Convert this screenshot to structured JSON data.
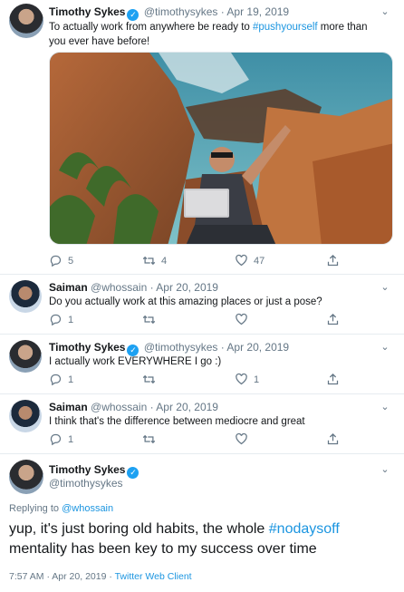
{
  "tweets": [
    {
      "name": "Timothy Sykes",
      "handle": "@timothysykes",
      "date": "Apr 19, 2019",
      "text_before": "To actually work from anywhere be ready to ",
      "hashtag": "#pushyourself",
      "text_after": " more than you ever have before!",
      "replies": "5",
      "retweets": "4",
      "likes": "47"
    },
    {
      "name": "Saiman",
      "handle": "@whossain",
      "date": "Apr 20, 2019",
      "text": "Do you actually work at this amazing places or just a pose?",
      "replies": "1",
      "retweets": "",
      "likes": ""
    },
    {
      "name": "Timothy Sykes",
      "handle": "@timothysykes",
      "date": "Apr 20, 2019",
      "text": "I actually work EVERYWHERE I go :)",
      "replies": "1",
      "retweets": "",
      "likes": "1"
    },
    {
      "name": "Saiman",
      "handle": "@whossain",
      "date": "Apr 20, 2019",
      "text": "I think that's the difference between mediocre and great",
      "replies": "1",
      "retweets": "",
      "likes": ""
    }
  ],
  "main": {
    "name": "Timothy Sykes",
    "handle": "@timothysykes",
    "replying_prefix": "Replying to ",
    "replying_handle": "@whossain",
    "text_before": "yup, it's just boring old habits, the whole ",
    "hashtag": "#nodaysoff",
    "text_after": " mentality has been key to my success over time",
    "time": "7:57 AM",
    "date": "Apr 20, 2019",
    "client": "Twitter Web Client"
  },
  "separator": " · ",
  "verified_mark": "✓",
  "caret": "⌄",
  "colors": {
    "accent": "#1b95e0",
    "verified": "#1da1f2",
    "muted": "#657786",
    "text": "#14171a"
  },
  "icons": [
    "reply-icon",
    "retweet-icon",
    "like-icon",
    "share-icon",
    "verified-icon",
    "caret-down-icon"
  ]
}
